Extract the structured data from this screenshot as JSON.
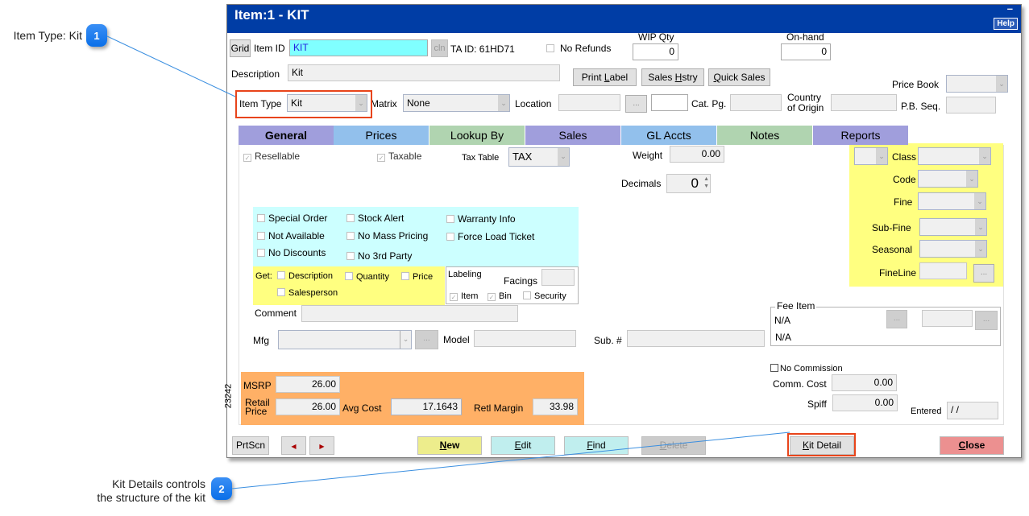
{
  "callouts": [
    {
      "number": "1",
      "text": "Item Type: Kit"
    },
    {
      "number": "2",
      "text_line1": "Kit Details controls",
      "text_line2": "the structure of the kit"
    }
  ],
  "window": {
    "title": "Item:1 - KIT",
    "minimize": "–",
    "help_label": "Help"
  },
  "header": {
    "grid_label": "Grid",
    "item_id_label": "Item ID",
    "item_id_value": "KIT",
    "cln_label": "cln",
    "ta_id": "TA ID: 61HD71",
    "no_refunds_label": "No Refunds",
    "wip_qty_label": "WIP Qty",
    "wip_qty_value": "0",
    "on_hand_label": "On-hand",
    "on_hand_value": "0",
    "description_label": "Description",
    "description_value": "Kit",
    "print_label_btn": {
      "pre": "Print ",
      "u": "L",
      "post": "abel"
    },
    "sales_hstry_btn": {
      "pre": "Sales ",
      "u": "H",
      "post": "stry"
    },
    "quick_sales_btn": {
      "pre": "",
      "u": "Q",
      "post": "uick Sales"
    },
    "price_book_label": "Price Book",
    "price_book_value": "",
    "item_type_label": "Item Type",
    "item_type_value": "Kit",
    "matrix_label": "Matrix",
    "matrix_value": "None",
    "location_label": "Location",
    "location_value": "",
    "dots": "...",
    "cat_pg_label": "Cat. Pg.",
    "cat_pg_value": "",
    "country_label_1": "Country",
    "country_label_2": "of Origin",
    "country_value": "",
    "pb_seq_label": "P.B. Seq.",
    "pb_seq_value": ""
  },
  "tabs": [
    {
      "label": "General",
      "color": "#a09edc",
      "active": true
    },
    {
      "label": "Prices",
      "color": "#92c0ec",
      "active": false
    },
    {
      "label": "Lookup By",
      "color": "#b0d4b0",
      "active": false
    },
    {
      "label": "Sales",
      "color": "#a09edc",
      "active": false
    },
    {
      "label": "GL Accts",
      "color": "#92c0ec",
      "active": false
    },
    {
      "label": "Notes",
      "color": "#b0d4b0",
      "active": false
    },
    {
      "label": "Reports",
      "color": "#a09edc",
      "active": false
    }
  ],
  "general": {
    "resellable": {
      "label": "Resellable",
      "checked": true
    },
    "taxable": {
      "label": "Taxable",
      "checked": true
    },
    "tax_table_label": "Tax Table",
    "tax_table_value": "TAX",
    "weight_label": "Weight",
    "weight_value": "0.00",
    "decimals_label": "Decimals",
    "decimals_value": "0",
    "flags": [
      {
        "label": "Special Order",
        "checked": false
      },
      {
        "label": "Stock Alert",
        "checked": false
      },
      {
        "label": "Warranty Info",
        "checked": false
      },
      {
        "label": "Not Available",
        "checked": false
      },
      {
        "label": "No Mass Pricing",
        "checked": false
      },
      {
        "label": "Force Load Ticket",
        "checked": false
      },
      {
        "label": "No Discounts",
        "checked": false
      },
      {
        "label": "No 3rd Party",
        "checked": false
      }
    ],
    "get_label": "Get:",
    "get_options": [
      {
        "label": "Description",
        "checked": false
      },
      {
        "label": "Quantity",
        "checked": false
      },
      {
        "label": "Price",
        "checked": false
      },
      {
        "label": "Salesperson",
        "checked": false
      }
    ],
    "labeling": {
      "title": "Labeling",
      "facings_label": "Facings",
      "facings_value": "",
      "item": {
        "label": "Item",
        "checked": true
      },
      "bin": {
        "label": "Bin",
        "checked": true
      },
      "security": {
        "label": "Security",
        "checked": false
      }
    },
    "comment_label": "Comment",
    "comment_value": "",
    "mfg_label": "Mfg",
    "mfg_value": "",
    "model_label": "Model",
    "model_value": "",
    "sub_label": "Sub. #",
    "sub_value": "",
    "classification": {
      "class_label": "Class",
      "code_label": "Code",
      "fine_label": "Fine",
      "subfine_label": "Sub-Fine",
      "seasonal_label": "Seasonal",
      "fineline_label": "FineLine"
    },
    "fee_item": {
      "title": "Fee Item",
      "line1": "N/A",
      "line2": "N/A"
    },
    "no_commission": {
      "label": "No Commission",
      "checked": false
    },
    "comm_cost_label": "Comm. Cost",
    "comm_cost_value": "0.00",
    "spiff_label": "Spiff",
    "spiff_value": "0.00",
    "entered_label": "Entered",
    "entered_value": " /  /",
    "side_number": "23242",
    "pricing": {
      "msrp_label": "MSRP",
      "msrp_value": "26.00",
      "retail_label_1": "Retail",
      "retail_label_2": "Price",
      "retail_value": "26.00",
      "avg_cost_label": "Avg Cost",
      "avg_cost_value": "17.1643",
      "retl_margin_label": "Retl Margin",
      "retl_margin_value": "33.98"
    }
  },
  "footer": {
    "prtscn": "PrtScn",
    "prev_icon": "◀",
    "next_icon": "▶",
    "new": {
      "u": "N",
      "post": "ew"
    },
    "edit": {
      "u": "E",
      "post": "dit"
    },
    "find": {
      "u": "F",
      "post": "ind"
    },
    "delete": {
      "u": "D",
      "post": "elete"
    },
    "kit_detail": {
      "u": "K",
      "post": "it Detail"
    },
    "close": {
      "u": "C",
      "post": "lose"
    }
  }
}
